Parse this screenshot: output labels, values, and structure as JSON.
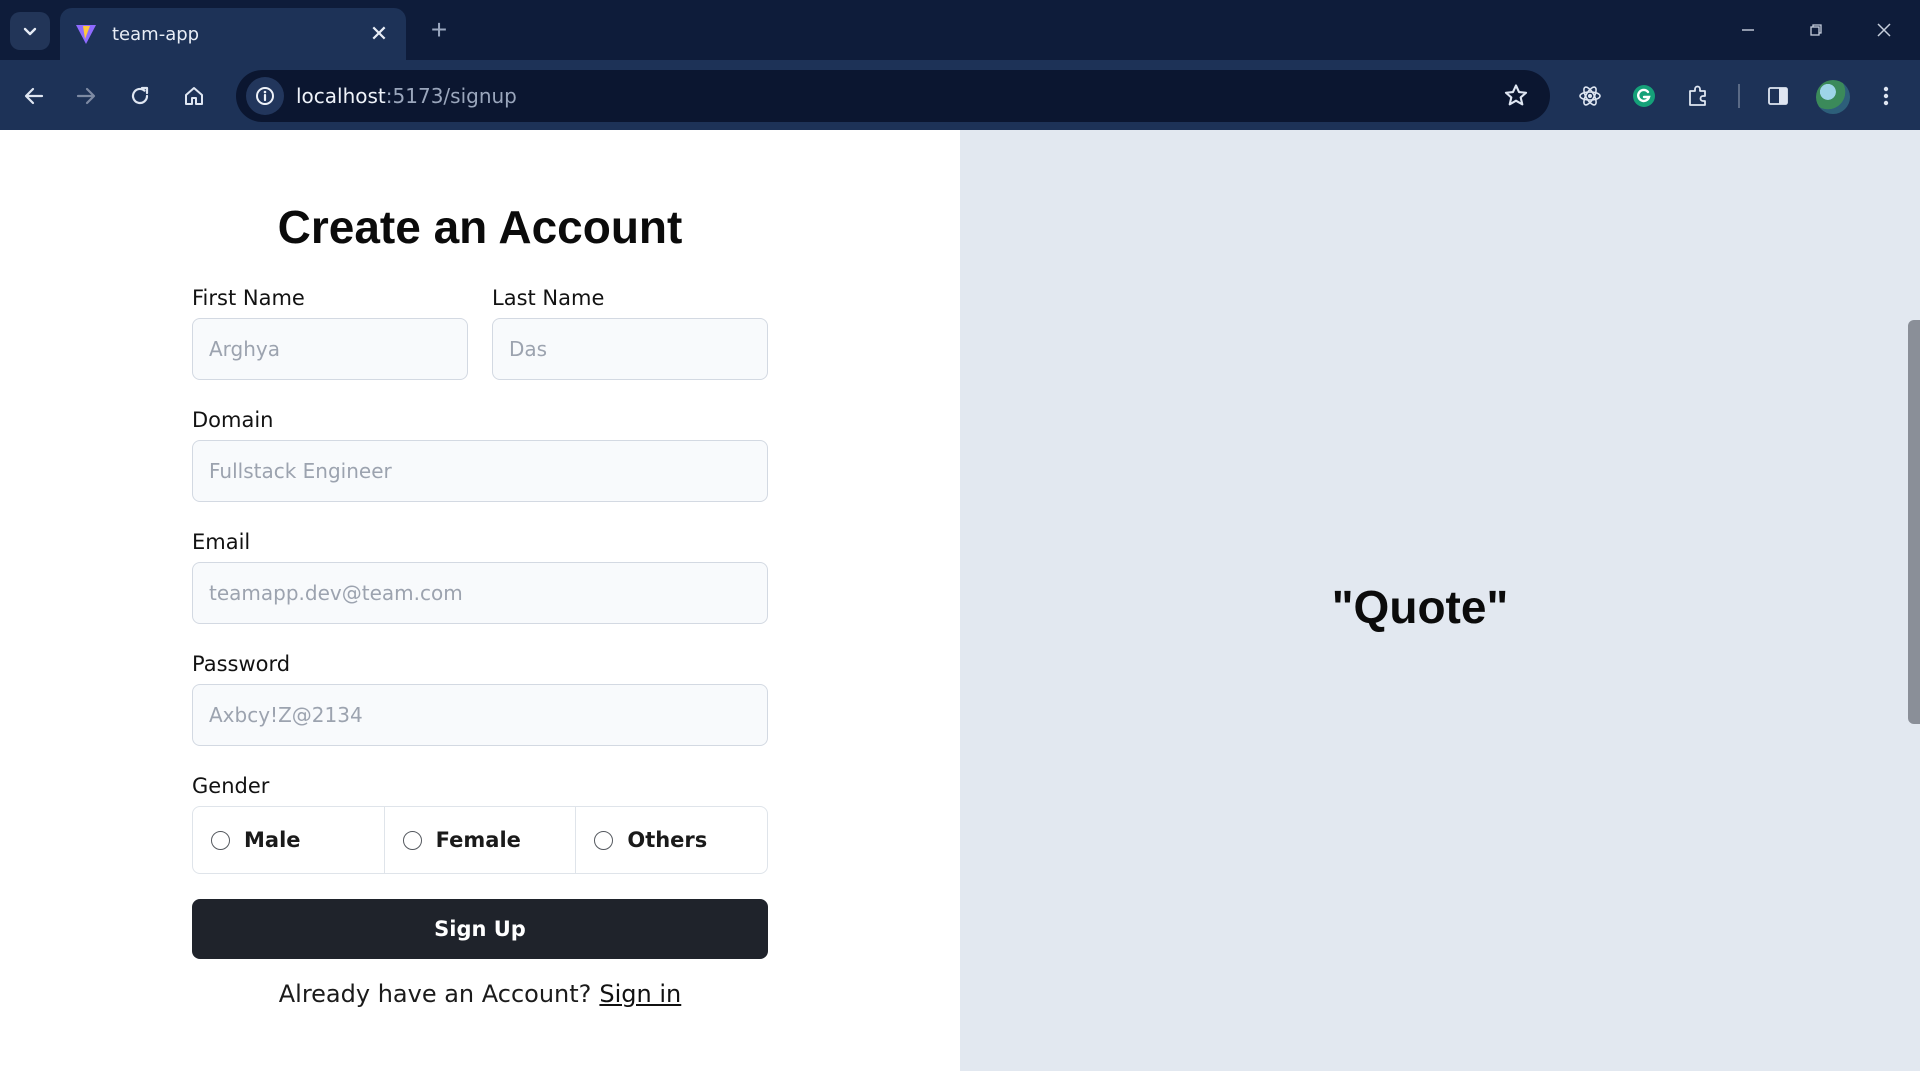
{
  "browser": {
    "tab_title": "team-app",
    "tab_close": "✕",
    "new_tab": "+",
    "url_host": "localhost",
    "url_path": ":5173/signup",
    "icons": [
      "tab-search-icon",
      "vite-favicon-icon",
      "back-icon",
      "forward-icon",
      "reload-icon",
      "home-icon",
      "site-info-icon",
      "bookmark-star-icon",
      "react-devtools-icon",
      "grammarly-icon",
      "extensions-icon",
      "side-panel-icon",
      "profile-avatar",
      "more-menu-icon",
      "minimize-icon",
      "restore-icon",
      "window-close-icon"
    ]
  },
  "form": {
    "title": "Create an Account",
    "first_name": {
      "label": "First Name",
      "placeholder": "Arghya"
    },
    "last_name": {
      "label": "Last Name",
      "placeholder": "Das"
    },
    "domain": {
      "label": "Domain",
      "placeholder": "Fullstack Engineer"
    },
    "email": {
      "label": "Email",
      "placeholder": "teamapp.dev@team.com"
    },
    "password": {
      "label": "Password",
      "placeholder": "Axbcy!Z@2134"
    },
    "gender": {
      "label": "Gender",
      "options": [
        "Male",
        "Female",
        "Others"
      ]
    },
    "submit_label": "Sign Up",
    "signin_prompt": "Already have an Account?",
    "signin_link": "Sign in"
  },
  "side_panel": {
    "quote": "\"Quote\""
  },
  "colors": {
    "chrome_dark": "#0e1c3a",
    "chrome_toolbar": "#1d3257",
    "panel_bg": "#e2e8f0",
    "button_bg": "#1f232b"
  }
}
